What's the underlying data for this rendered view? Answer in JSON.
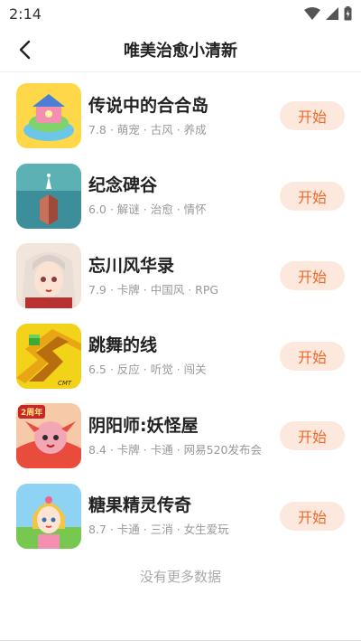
{
  "status_bar": {
    "time": "2:14"
  },
  "header": {
    "title": "唯美治愈小清新"
  },
  "games": [
    {
      "name": "传说中的合合岛",
      "meta": "7.8 · 萌宠 · 古风 · 养成",
      "button": "开始",
      "icon": "island-game-icon"
    },
    {
      "name": "纪念碑谷",
      "meta": "6.0 · 解谜 · 治愈 · 情怀",
      "button": "开始",
      "icon": "monument-game-icon"
    },
    {
      "name": "忘川风华录",
      "meta": "7.9 · 卡牌 · 中国风 · RPG",
      "button": "开始",
      "icon": "heroine-game-icon"
    },
    {
      "name": "跳舞的线",
      "meta": "6.5 · 反应 · 听觉 · 闯关",
      "button": "开始",
      "icon": "dancing-line-game-icon"
    },
    {
      "name": "阴阳师:妖怪屋",
      "meta": "8.4 · 卡牌 · 卡通 · 网易520发布会",
      "button": "开始",
      "icon": "onmyoji-game-icon"
    },
    {
      "name": "糖果精灵传奇",
      "meta": "8.7 · 卡通 · 三消 · 女生爱玩",
      "button": "开始",
      "icon": "candy-game-icon"
    }
  ],
  "icon_badges": {
    "anniversary": "2周年",
    "publisher": "CMT"
  },
  "footer": {
    "no_more": "没有更多数据"
  },
  "colors": {
    "accent": "#f06a2b",
    "button_bg": "#fde8de"
  }
}
